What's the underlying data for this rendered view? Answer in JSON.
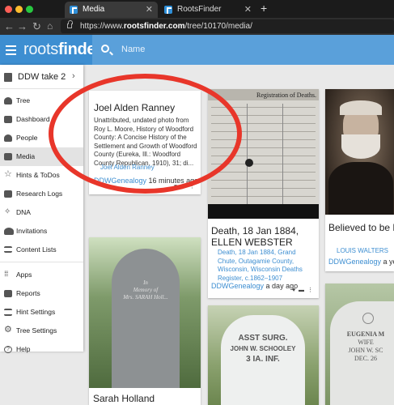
{
  "browser": {
    "tabs": [
      {
        "label": "Media",
        "active": true
      },
      {
        "label": "RootsFinder",
        "active": false
      }
    ],
    "new_tab": "+",
    "url_prefix": "https://www.",
    "url_domain": "rootsfinder.com",
    "url_path": "/tree/10170/media/"
  },
  "app": {
    "logo_light": "roots",
    "logo_bold": "finder",
    "search_placeholder": "Name",
    "brand_color": "#3d8ed1"
  },
  "sidebar": {
    "tree_name": "DDW take 2",
    "chevron": "›",
    "items": [
      {
        "label": "Tree",
        "icon": "tree-icon"
      },
      {
        "label": "Dashboard",
        "icon": "dashboard-icon"
      },
      {
        "label": "People",
        "icon": "person-icon"
      },
      {
        "label": "Media",
        "icon": "image-icon",
        "active": true
      },
      {
        "label": "Hints & ToDos",
        "icon": "star-icon"
      },
      {
        "label": "Research Logs",
        "icon": "book-icon"
      },
      {
        "label": "DNA",
        "icon": "dna-icon"
      },
      {
        "label": "Invitations",
        "icon": "people-icon"
      },
      {
        "label": "Content Lists",
        "icon": "list-icon"
      },
      {
        "label": "Apps",
        "icon": "apps-icon"
      },
      {
        "label": "Reports",
        "icon": "printer-icon"
      },
      {
        "label": "Hint Settings",
        "icon": "sliders-icon"
      },
      {
        "label": "Tree Settings",
        "icon": "gear-icon"
      },
      {
        "label": "Help",
        "icon": "help-icon"
      }
    ]
  },
  "cards": [
    {
      "title": "Joel Alden Ranney",
      "desc": "Unattributed, undated photo from Roy L. Moore, History of Woodford County: A Concise History of the Settlement and Growth of Woodford County (Eureka, Ill.: Woodford County Republican, 1910), 31; di...",
      "person": "Joel Alden Ranney",
      "user": "DDWGenealogy",
      "time": "16 minutes ago"
    },
    {
      "title": "Death, 18 Jan 1884, ELLEN WEBSTER",
      "desc": "Death, 18 Jan 1884, Grand Chute, Outagamie County, Wisconsin, Wisconsin Deaths Register, c.1862–1907",
      "user": "DDWGenealogy",
      "time": "a day ago",
      "image_label": "Registration of Deaths."
    },
    {
      "title": "Believed to be Lo... Walters",
      "person": "LOUIS WALTERS",
      "user": "DDWGenealogy",
      "time": "a ye..."
    },
    {
      "title": "Sarah Holland"
    }
  ],
  "gravestones": {
    "holland_lines": [
      "In",
      "Memory of",
      "Mrs. SARAH Holl..."
    ],
    "assturg_lines": [
      "ASST SURG.",
      "JOHN W. SCHOOLEY",
      "3 IA. INF."
    ],
    "eugenia_lines": [
      "EUGENIA M",
      "WIFE",
      "JOHN W. SC",
      "DEC. 26"
    ]
  },
  "annotation": {
    "color": "#e8362a"
  }
}
